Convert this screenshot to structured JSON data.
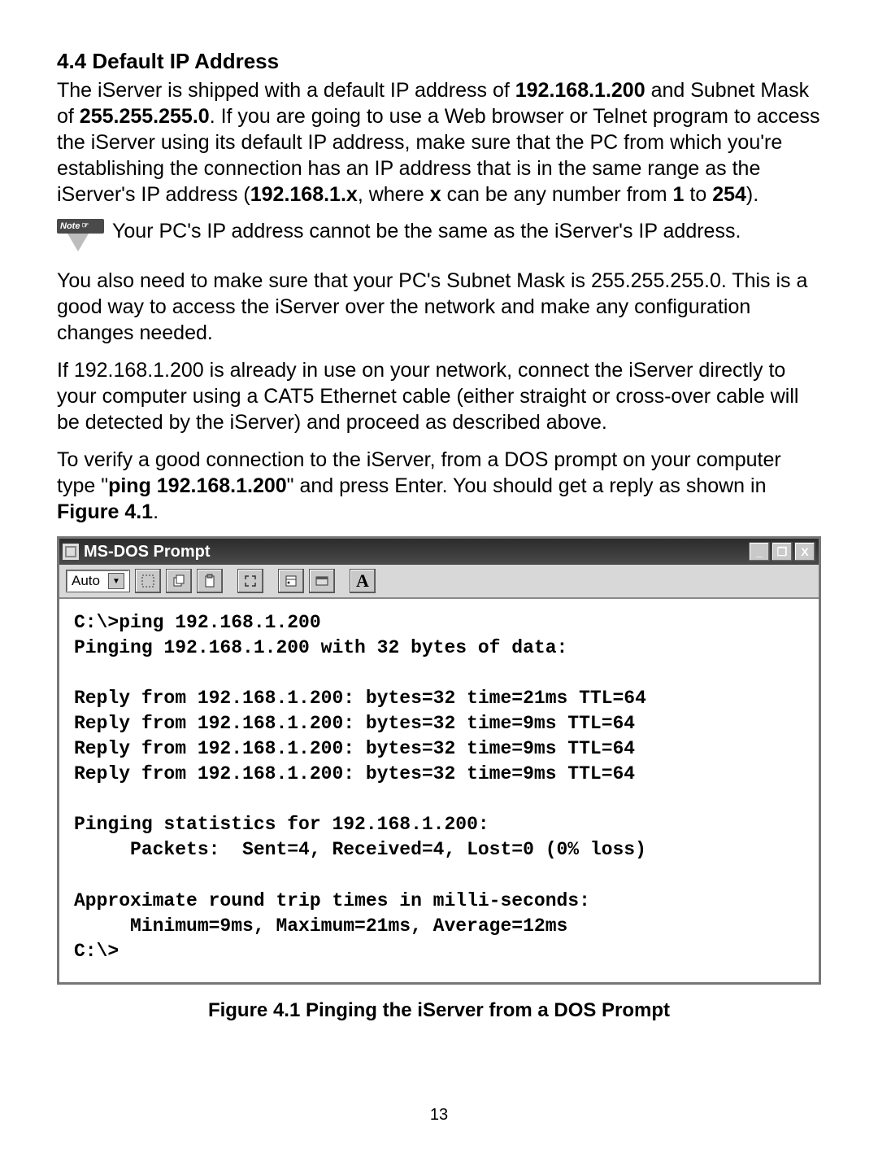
{
  "heading": "4.4  Default IP Address",
  "para1_pre": "The iServer is shipped with a default IP address of ",
  "ip_addr": "192.168.1.200",
  "para1_mid1": " and Subnet Mask of ",
  "mask": "255.255.255.0",
  "para1_mid2": ". If you are going to use a Web browser or Telnet program to access the iServer using its default IP address, make sure that the PC from which you're establishing the connection has an IP address that is in the same range as the iServer's IP address (",
  "range_ip": "192.168.1.x",
  "para1_mid3": ", where ",
  "x_label": "x",
  "para1_mid4": " can be any number from ",
  "one": "1",
  "para1_mid5": " to ",
  "n254": "254",
  "para1_end": ").",
  "note_label": "Note",
  "note_text": "Your PC's IP address cannot be the same as the iServer's IP address.",
  "para2": "You also need to make sure that your PC's Subnet Mask is 255.255.255.0. This is a good way to access the iServer over the network and make any configuration changes needed.",
  "para3": "If 192.168.1.200 is already in use on your network, connect the iServer directly to your computer using a CAT5 Ethernet cable (either straight or cross-over cable will be detected by the iServer) and proceed as described above.",
  "para4_pre": "To verify a good connection to the iServer, from a DOS prompt on your computer type \"",
  "ping_cmd": "ping 192.168.1.200",
  "para4_mid": "\" and press Enter. You should get a reply as shown in ",
  "fig_ref": "Figure 4.1",
  "para4_end": ".",
  "dos": {
    "title": "MS-DOS Prompt",
    "auto": "Auto",
    "min": "_",
    "max": "❐",
    "close": "X",
    "lines": "C:\\>ping 192.168.1.200\nPinging 192.168.1.200 with 32 bytes of data:\n\nReply from 192.168.1.200: bytes=32 time=21ms TTL=64\nReply from 192.168.1.200: bytes=32 time=9ms TTL=64\nReply from 192.168.1.200: bytes=32 time=9ms TTL=64\nReply from 192.168.1.200: bytes=32 time=9ms TTL=64\n\nPinging statistics for 192.168.1.200:\n     Packets:  Sent=4, Received=4, Lost=0 (0% loss)\n\nApproximate round trip times in milli-seconds:\n     Minimum=9ms, Maximum=21ms, Average=12ms\nC:\\>"
  },
  "figure_caption": "Figure 4.1  Pinging the iServer from a DOS Prompt",
  "page_number": "13"
}
